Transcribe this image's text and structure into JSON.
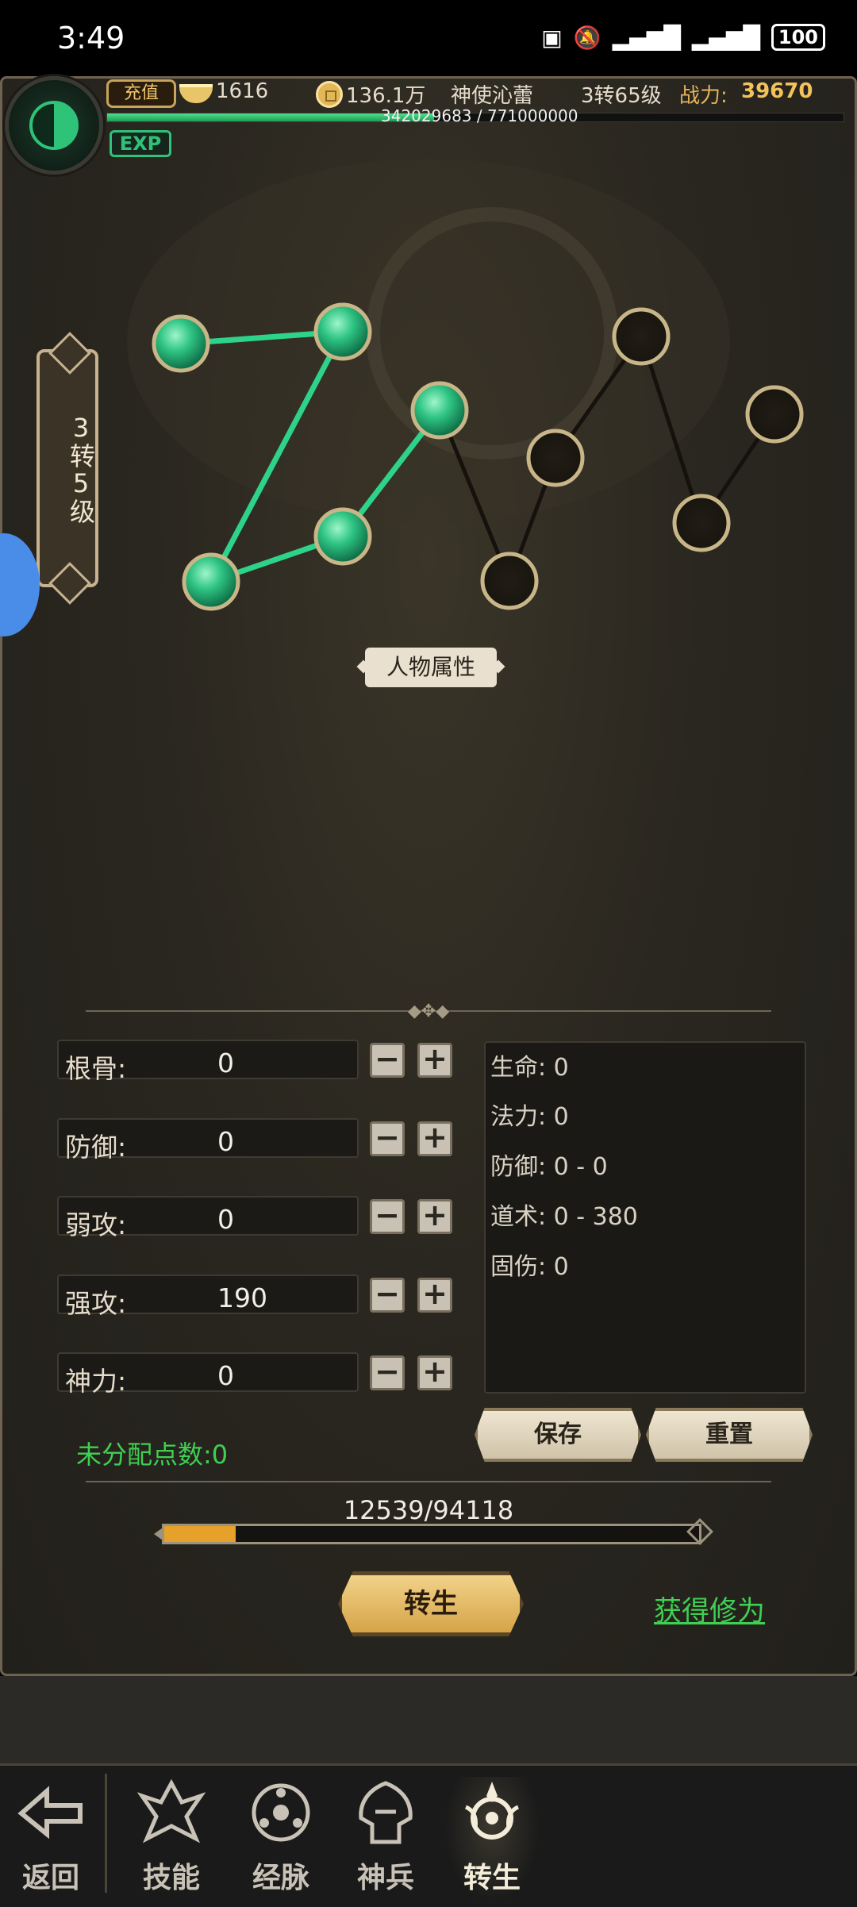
{
  "status_bar": {
    "time": "3:49",
    "battery": "100",
    "icons": [
      "nfc-icon",
      "mute-icon",
      "signal-4g-icon",
      "signal-4g-icon"
    ]
  },
  "hud": {
    "recharge_label": "充值",
    "ingot_count": "1616",
    "coin_amount": "136.1万",
    "player_name": "神使沁蕾",
    "player_level": "3转65级",
    "power_label": "战力:",
    "power_value": "39670",
    "exp_badge": "EXP",
    "exp_text": "342029683 / 771000000",
    "exp_fraction": 0.4436
  },
  "level_plaque": "3转5级",
  "attr_tag": "人物属性",
  "stats": [
    {
      "label": "根骨:",
      "value": "0"
    },
    {
      "label": "防御:",
      "value": "0"
    },
    {
      "label": "弱攻:",
      "value": "0"
    },
    {
      "label": "强攻:",
      "value": "190"
    },
    {
      "label": "神力:",
      "value": "0"
    }
  ],
  "derived_stats": [
    "生命: 0",
    "法力: 0",
    "防御: 0 - 0",
    "道术: 0 - 380",
    "固伤: 0"
  ],
  "unassigned_points": "未分配点数:0",
  "buttons": {
    "save": "保存",
    "reset": "重置",
    "rebirth": "转生",
    "gain": "获得修为",
    "minus": "−",
    "plus": "+"
  },
  "progress": {
    "text": "12539/94118",
    "fraction": 0.1332
  },
  "nav": {
    "back_label": "返回",
    "items": [
      {
        "label": "技能",
        "icon": "skill-icon"
      },
      {
        "label": "经脉",
        "icon": "meridian-icon"
      },
      {
        "label": "神兵",
        "icon": "weapon-icon"
      },
      {
        "label": "转生",
        "icon": "rebirth-icon"
      }
    ]
  }
}
